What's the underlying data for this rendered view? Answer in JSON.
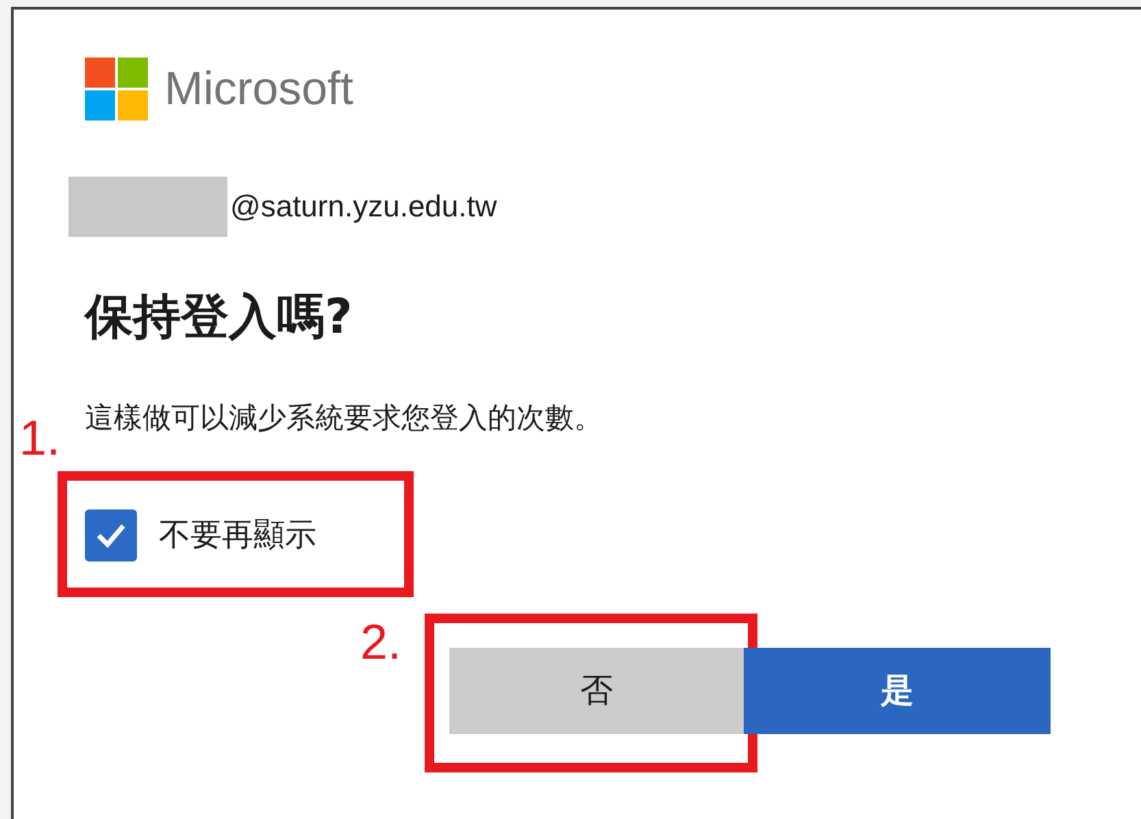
{
  "logo": {
    "text": "Microsoft"
  },
  "account": {
    "email": "@saturn.yzu.edu.tw"
  },
  "title": "保持登入嗎?",
  "description": "這樣做可以減少系統要求您登入的次數。",
  "checkbox": {
    "label": "不要再顯示",
    "checked": true,
    "annotation": "1."
  },
  "buttons": [
    {
      "label": "否",
      "kind": "secondary",
      "annotation": "2."
    },
    {
      "label": "是",
      "kind": "primary"
    }
  ]
}
